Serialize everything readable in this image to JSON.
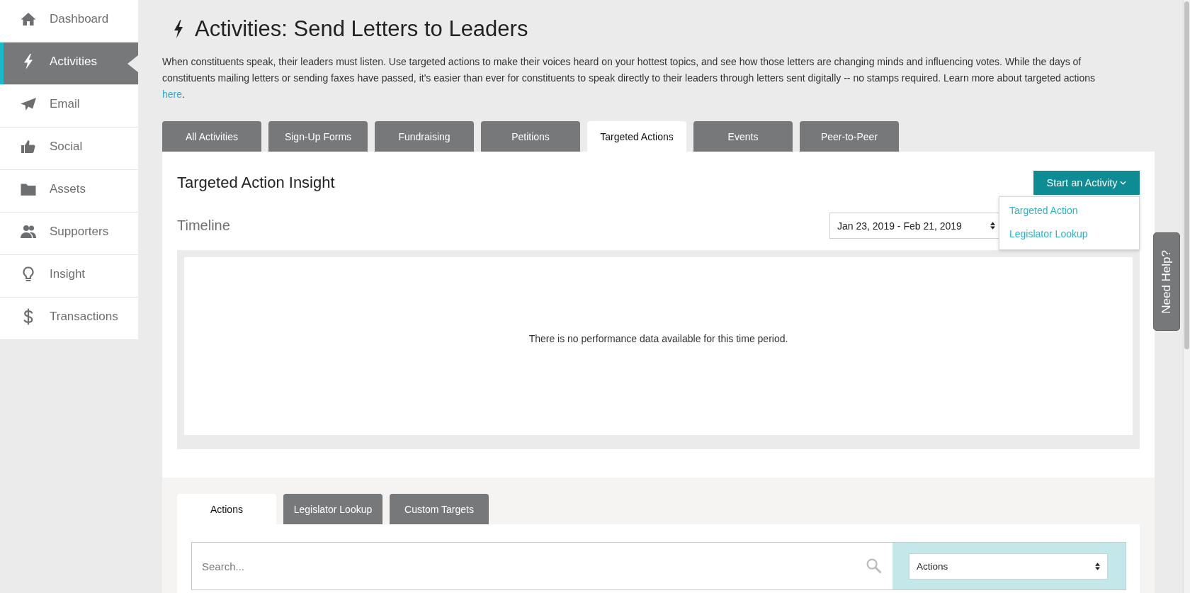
{
  "sidebar": {
    "items": [
      {
        "label": "Dashboard",
        "selected": false
      },
      {
        "label": "Activities",
        "selected": true
      },
      {
        "label": "Email",
        "selected": false
      },
      {
        "label": "Social",
        "selected": false
      },
      {
        "label": "Assets",
        "selected": false
      },
      {
        "label": "Supporters",
        "selected": false
      },
      {
        "label": "Insight",
        "selected": false
      },
      {
        "label": "Transactions",
        "selected": false
      }
    ]
  },
  "page": {
    "title": "Activities: Send Letters to Leaders",
    "intro": {
      "text": "When constituents speak, their leaders must listen. Use targeted actions to make their voices heard on your hottest topics, and see how those letters are changing minds and influencing votes. While the days of constituents mailing letters or sending faxes have passed, it's easier than ever for constituents to speak directly to their leaders through letters sent digitally -- no stamps required. Learn more about targeted actions",
      "link": "here",
      "after_link": "."
    }
  },
  "tabs": [
    {
      "label": "All Activities",
      "selected": false
    },
    {
      "label": "Sign-Up Forms",
      "selected": false
    },
    {
      "label": "Fundraising",
      "selected": false
    },
    {
      "label": "Petitions",
      "selected": false
    },
    {
      "label": "Targeted Actions",
      "selected": true
    },
    {
      "label": "Events",
      "selected": false
    },
    {
      "label": "Peer-to-Peer",
      "selected": false
    }
  ],
  "insight": {
    "title": "Targeted Action Insight",
    "start_button": {
      "label": "Start an Activity",
      "expanded": true,
      "menu": [
        "Targeted Action",
        "Legislator Lookup"
      ]
    },
    "timeline": {
      "title": "Timeline",
      "date_range": "Jan 23, 2019 - Feb 21, 2019",
      "message": "There is no performance data available for this time period."
    }
  },
  "lower": {
    "tabs": [
      {
        "label": "Actions",
        "selected": true
      },
      {
        "label": "Legislator Lookup",
        "selected": false
      },
      {
        "label": "Custom Targets",
        "selected": false
      }
    ],
    "search": {
      "placeholder": "Search..."
    },
    "filter": {
      "value": "Actions"
    }
  },
  "help_tab": {
    "label": "Need Help?"
  }
}
